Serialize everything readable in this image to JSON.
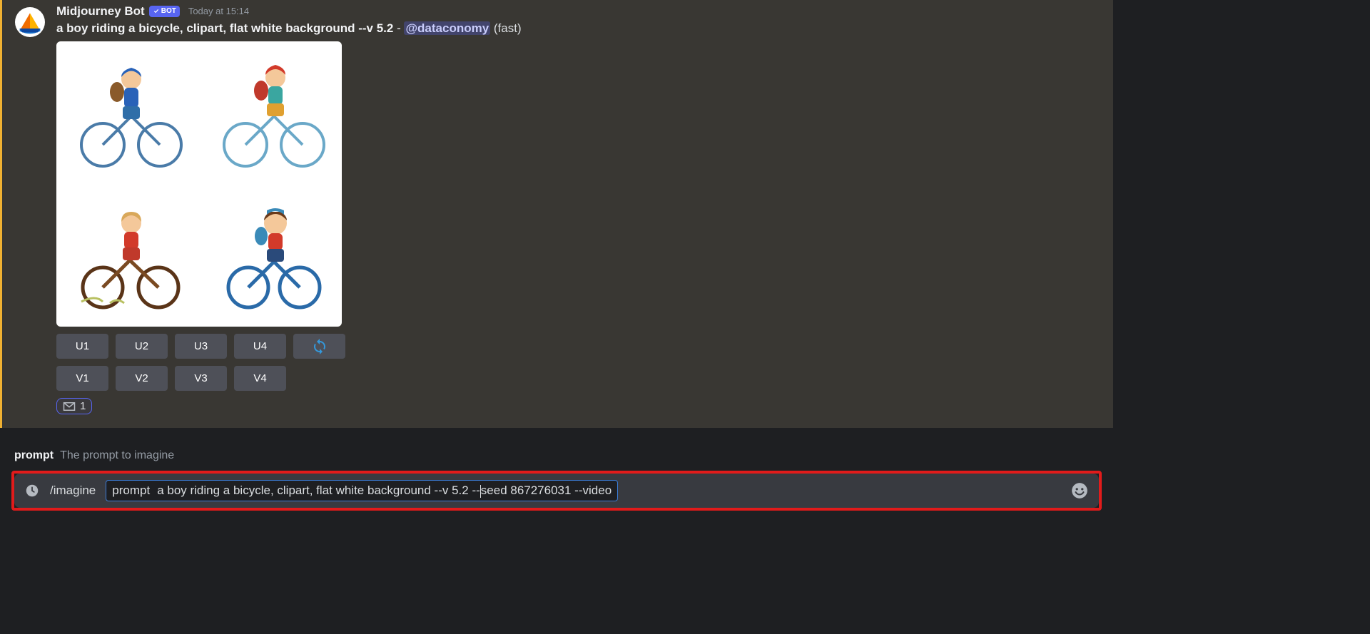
{
  "message": {
    "author": "Midjourney Bot",
    "badge": "BOT",
    "timestamp": "Today at 15:14",
    "prompt_text": "a boy riding a bicycle, clipart, flat white background --v 5.2",
    "dash": " - ",
    "mention": "@dataconomy",
    "speed": " (fast)"
  },
  "buttons": {
    "u1": "U1",
    "u2": "U2",
    "u3": "U3",
    "u4": "U4",
    "v1": "V1",
    "v2": "V2",
    "v3": "V3",
    "v4": "V4"
  },
  "reaction": {
    "count": "1"
  },
  "hint": {
    "label": "prompt",
    "desc": "The prompt to imagine"
  },
  "input": {
    "command": "/imagine",
    "param_name": "prompt",
    "param_value_before": "a boy riding a bicycle, clipart, flat white background --v 5.2 --",
    "param_value_after": "seed 867276031 --video"
  }
}
